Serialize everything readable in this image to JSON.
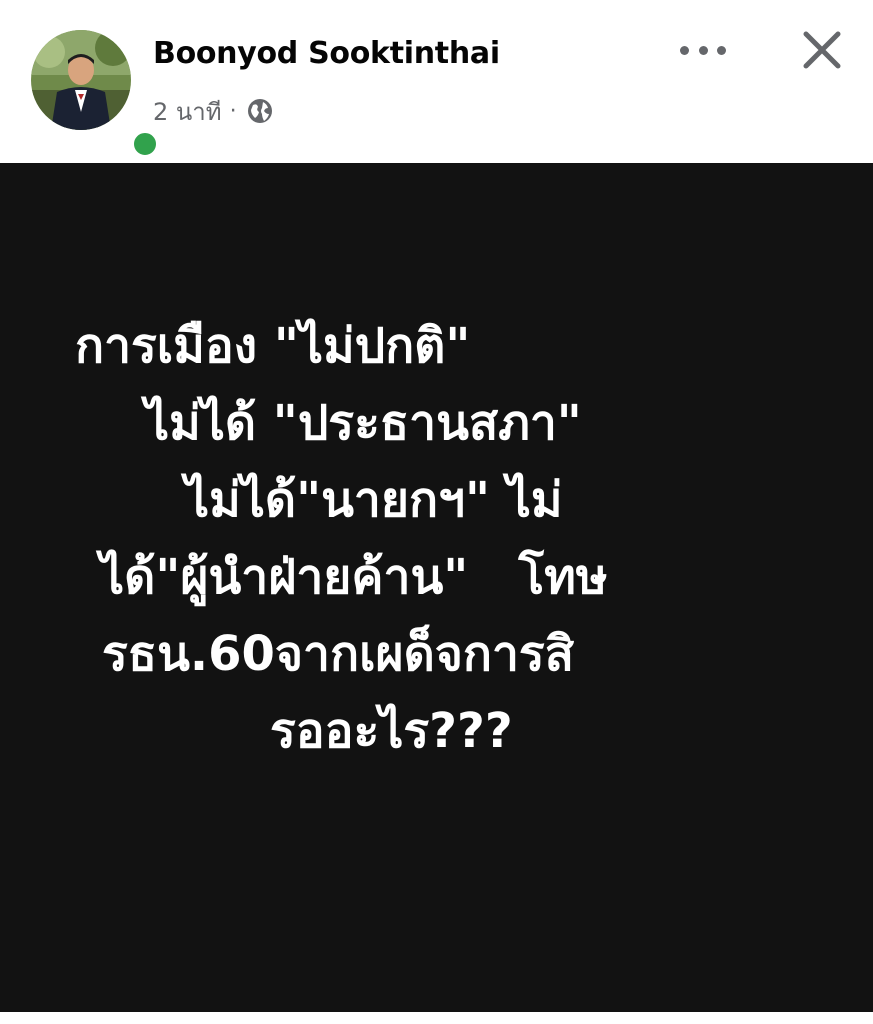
{
  "post": {
    "author": "Boonyod Sooktinthai",
    "time": "2 นาที",
    "separator": "·",
    "privacy_icon": "globe-icon",
    "author_online": true
  },
  "header_actions": {
    "more_icon": "more-options-icon",
    "close_icon": "close-icon"
  },
  "content": {
    "background": "#121212",
    "text_color": "#ffffff",
    "lines": [
      "การเมือง \"ไม่ปกติ\"",
      "ไม่ได้ \"ประธานสภา\"",
      "ไม่ได้\"นายกฯ\" ไม่",
      "ได้\"ผู้นำฝ่ายค้าน\"   โทษ",
      "รธน.60จากเผด็จการสิ",
      "รออะไร???"
    ]
  },
  "colors": {
    "online_status": "#31a24c",
    "meta_text": "#65676b"
  }
}
